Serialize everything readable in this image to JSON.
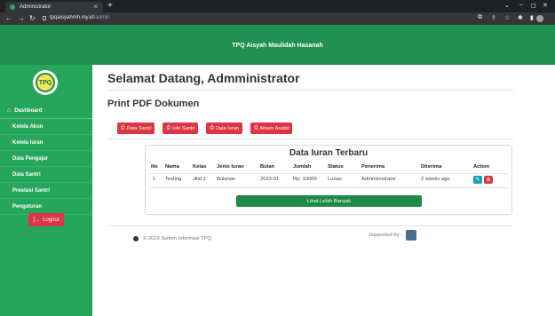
{
  "browser": {
    "tab_title": "Administrator",
    "url_host": "tpqaisyahmh.my.id",
    "url_path": "/admin"
  },
  "header": {
    "brand": "TPQ Aisyah Maulidah Hasanah"
  },
  "sidebar": {
    "logo_text": "TPQ",
    "items": [
      {
        "label": "Dashboard",
        "icon": "dashboard-icon"
      },
      {
        "label": "Kelola Akun"
      },
      {
        "label": "Kelola Iuran"
      },
      {
        "label": "Data Pengajar"
      },
      {
        "label": "Data Santri"
      },
      {
        "label": "Prestasi Santri"
      },
      {
        "label": "Pengaturan"
      }
    ],
    "logout_label": "Logout"
  },
  "main": {
    "welcome": "Selamat Datang, Admministrator",
    "print_title": "Print PDF Dokumen",
    "pdf_buttons": [
      "Data Santri",
      "Info Santri",
      "Data Iuran",
      "Absen Asatid"
    ]
  },
  "iuran": {
    "title": "Data Iuran Terbaru",
    "columns": [
      "No",
      "Nama",
      "Kelas",
      "Jenis Iuran",
      "Bulan",
      "Jumlah",
      "Status",
      "Penerima",
      "Diterima",
      "Action"
    ],
    "rows": [
      [
        "1",
        "Testing",
        "Jilid 2",
        "Bulanan",
        "2023-01",
        "Rp. 10000",
        "Lunas",
        "Admministrator",
        "2 weeks ago"
      ]
    ],
    "more_label": "Lihat Lebih Banyak"
  },
  "footer": {
    "copyright": "© 2023 Sistem Informasi TPQ",
    "supported": "Supported by :"
  },
  "colors": {
    "header_green": "#209150",
    "sidebar_green": "#26a65b",
    "danger_red": "#dc3545",
    "info_teal": "#17a2b8"
  }
}
